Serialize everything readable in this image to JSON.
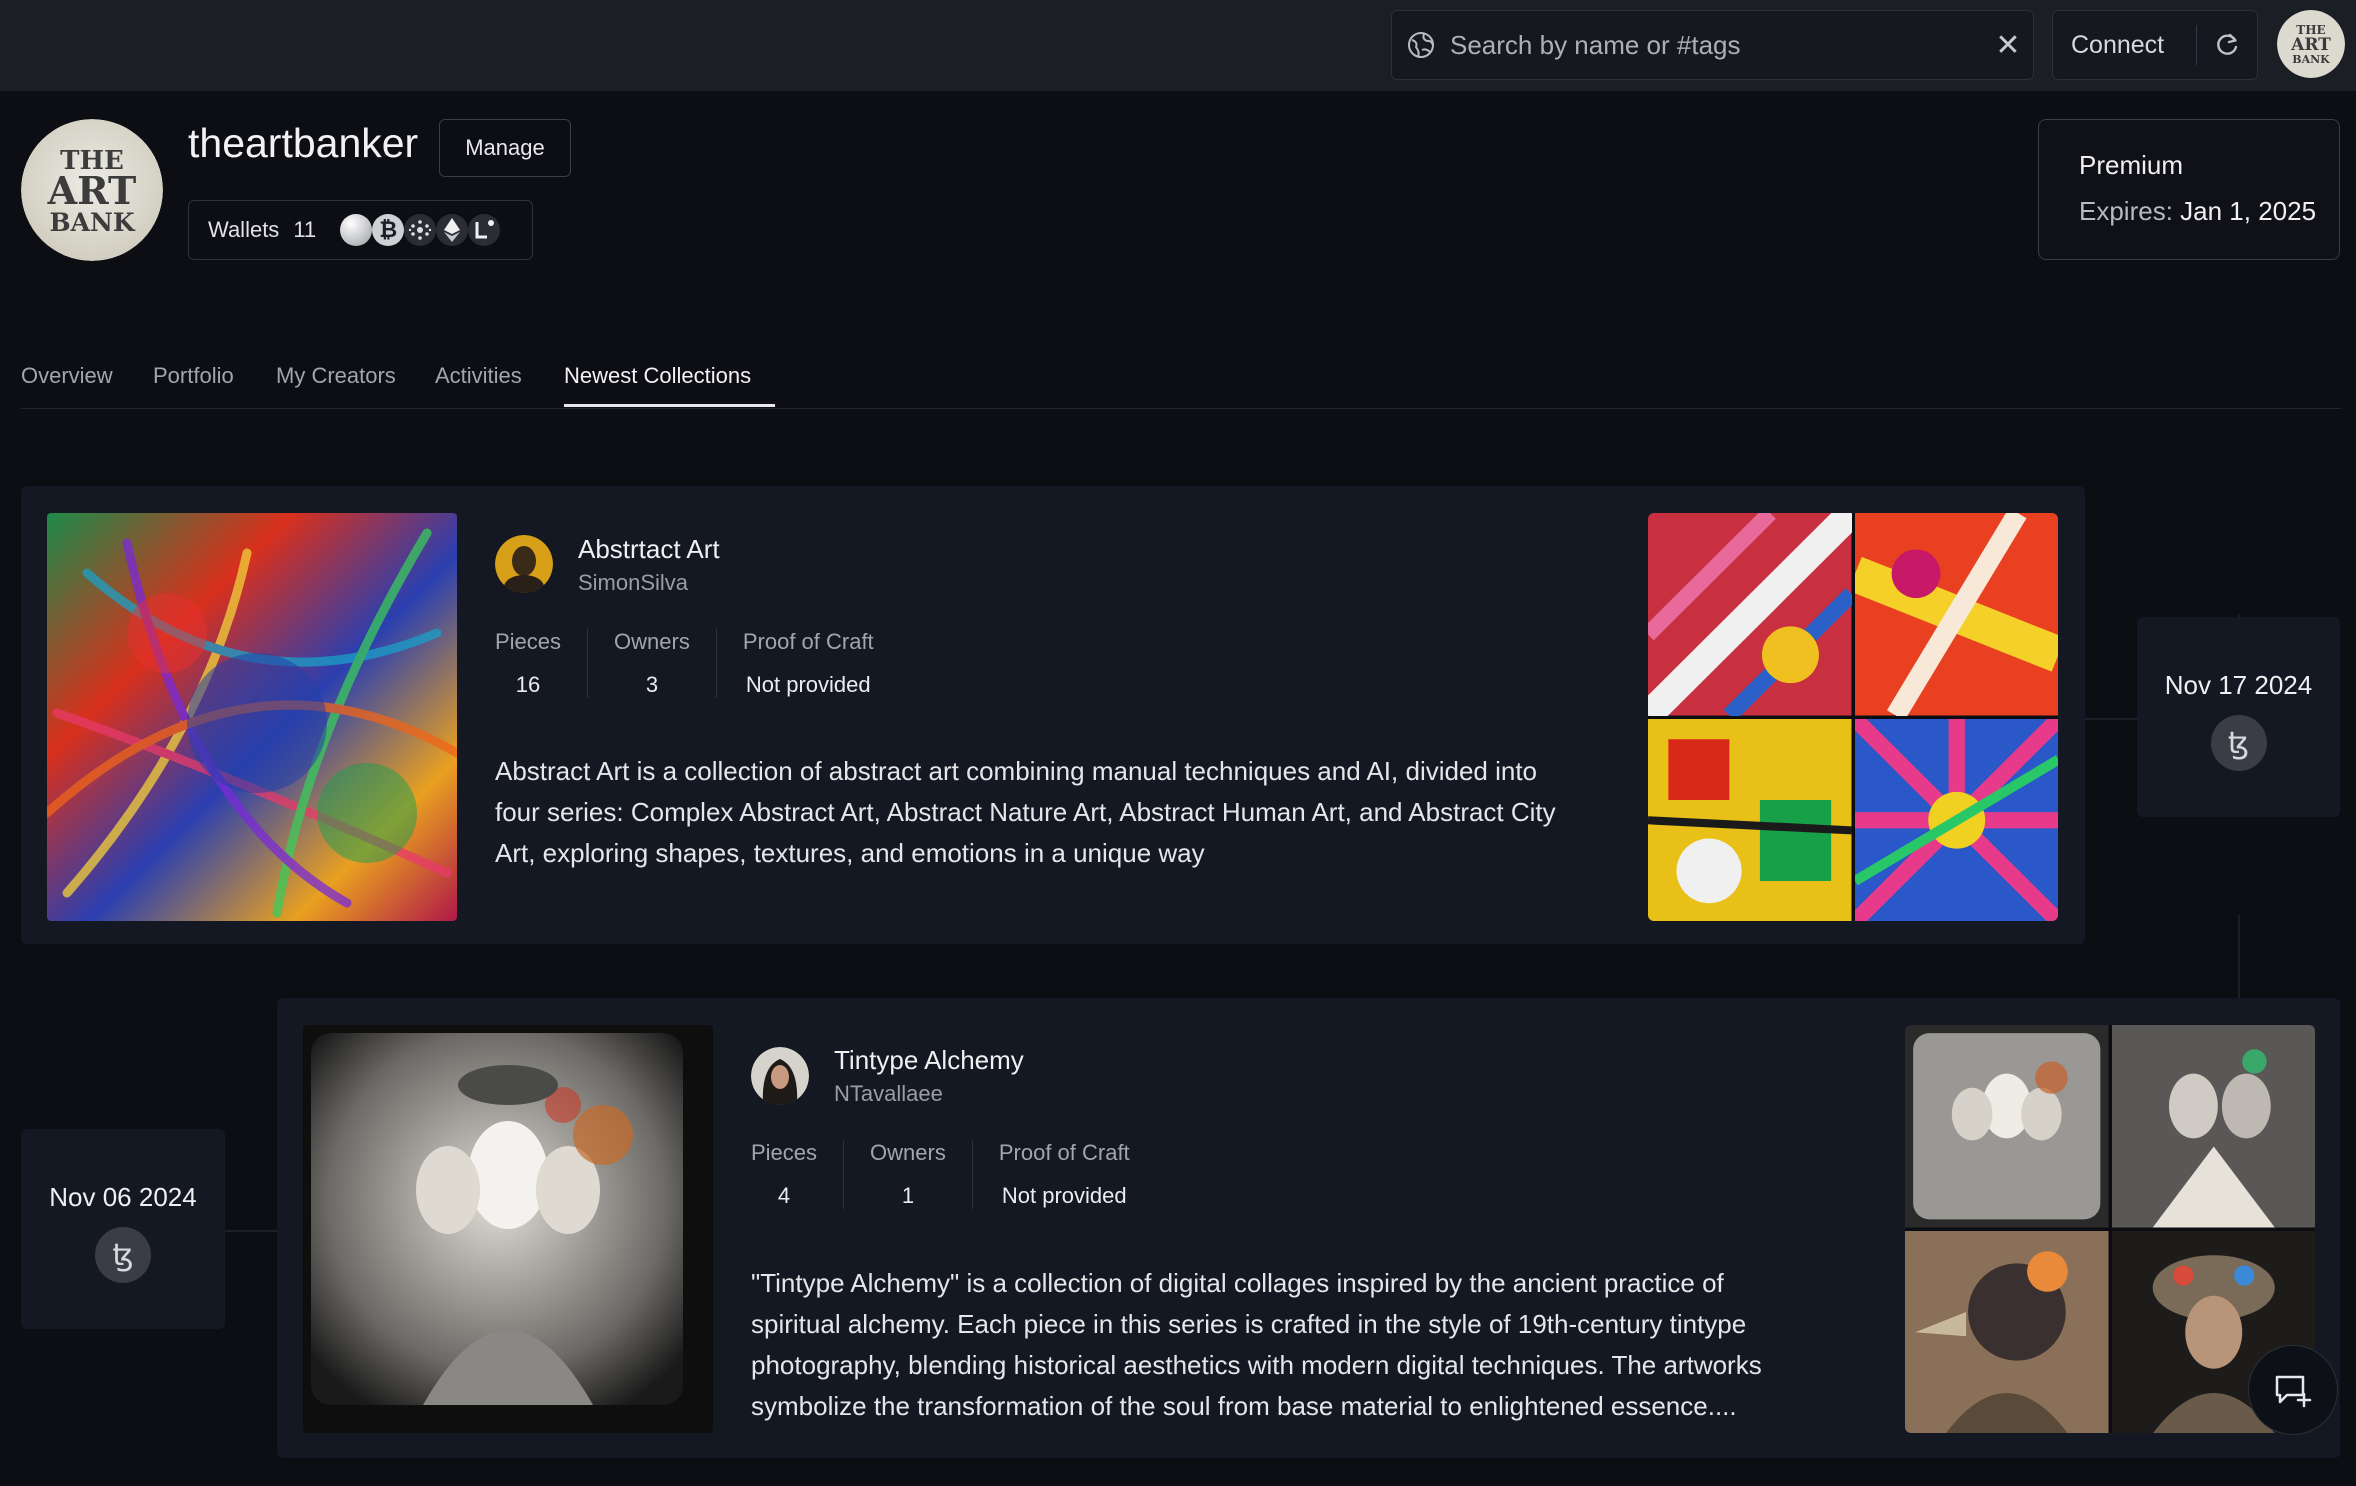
{
  "search": {
    "placeholder": "Search by name or #tags"
  },
  "header": {
    "connect_label": "Connect",
    "avatar_text": [
      "THE",
      "ART",
      "BANK"
    ]
  },
  "profile": {
    "username": "theartbanker",
    "manage_label": "Manage",
    "wallets_label": "Wallets",
    "wallets_count": "11",
    "chains": [
      "generic-chain-icon",
      "bitcoin-icon",
      "cardano-icon",
      "ethereum-icon",
      "lukso-icon"
    ],
    "avatar_text": [
      "THE",
      "ART",
      "BANK"
    ]
  },
  "premium": {
    "plan": "Premium",
    "expires_label": "Expires:",
    "expires_date": "Jan 1, 2025"
  },
  "tabs": [
    {
      "label": "Overview"
    },
    {
      "label": "Portfolio"
    },
    {
      "label": "My Creators"
    },
    {
      "label": "Activities"
    },
    {
      "label": "Newest Collections",
      "active": true
    }
  ],
  "collections": [
    {
      "title": "Abstrtact Art",
      "creator": "SimonSilva",
      "stats": {
        "pieces_label": "Pieces",
        "pieces": "16",
        "owners_label": "Owners",
        "owners": "3",
        "proof_label": "Proof of Craft",
        "proof": "Not provided"
      },
      "description": "Abstract Art  is a collection of abstract art combining manual techniques and AI, divided into four series: Complex Abstract Art, Abstract Nature Art, Abstract Human Art, and Abstract City Art, exploring shapes, textures, and emotions in a unique way",
      "date": "Nov 17 2024",
      "chain_icon": "tezos-icon"
    },
    {
      "title": "Tintype Alchemy",
      "creator": "NTavallaee",
      "stats": {
        "pieces_label": "Pieces",
        "pieces": "4",
        "owners_label": "Owners",
        "owners": "1",
        "proof_label": "Proof of Craft",
        "proof": "Not provided"
      },
      "description": "\"Tintype Alchemy\" is a collection of digital collages inspired by the ancient practice of spiritual alchemy. Each piece in this series is crafted in the style of 19th-century tintype photography, blending historical aesthetics with modern digital techniques. The artworks symbolize the transformation of the soul from base material to enlightened essence....",
      "date": "Nov 06 2024",
      "chain_icon": "tezos-icon"
    }
  ],
  "colors": {
    "background": "#0c0e14",
    "topbar": "#1b1e25",
    "card": "#141822",
    "accent_text": "#f2f2f5"
  }
}
